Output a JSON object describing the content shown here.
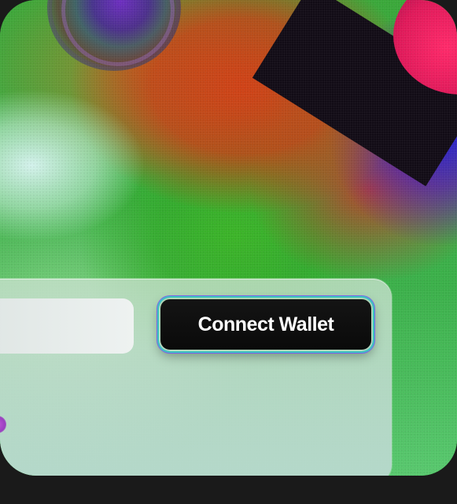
{
  "connect_button": {
    "label": "Connect Wallet"
  },
  "input": {
    "value": "",
    "placeholder": ""
  },
  "colors": {
    "button_bg": "#0a0a0a",
    "button_border": "#3cc6c0",
    "button_glow": "#785af0",
    "panel_bg": "#c8e1cd"
  }
}
